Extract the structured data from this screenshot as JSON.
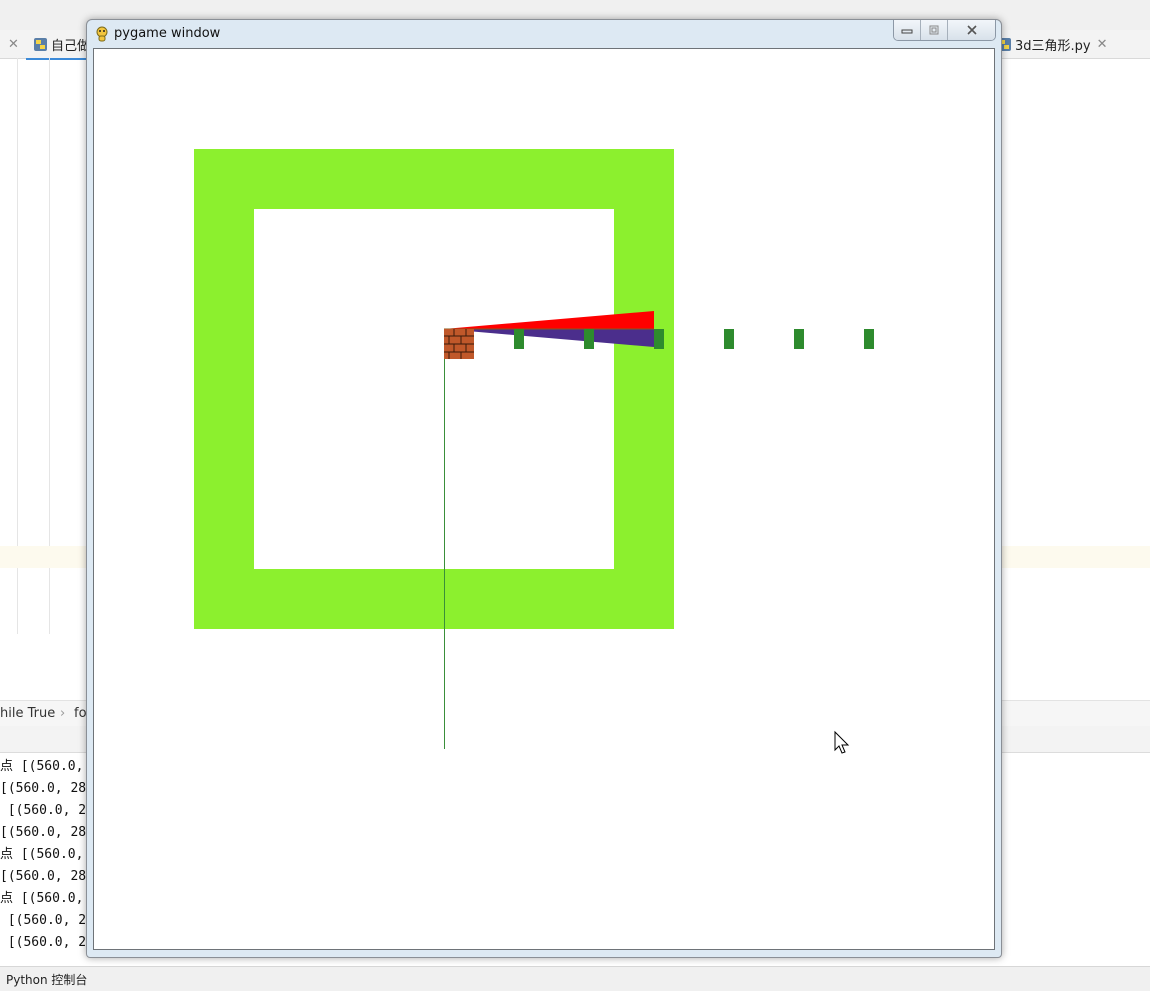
{
  "ide": {
    "tabs": [
      {
        "label": "",
        "close": "✕"
      },
      {
        "label": "自己做",
        "close": ""
      },
      {
        "label": "3d三角形.py",
        "close": "✕"
      }
    ],
    "breadcrumb": {
      "item1": "hile True",
      "sep": "›",
      "item2": "fo"
    },
    "console_lines": [
      "点 [(560.0,",
      "[(560.0, 28",
      " [(560.0, 2",
      "[(560.0, 28",
      "点 [(560.0,",
      "[(560.0, 28",
      "点 [(560.0,",
      " [(560.0, 2",
      " [(560.0, 2"
    ],
    "status_label": "Python 控制台"
  },
  "pygame": {
    "title": "pygame window",
    "colors": {
      "wall": "#8cf02e",
      "floor": "#ffffff",
      "ray_red": "#ff0000",
      "ray_purple": "#4b2e8c",
      "marker": "#2e8b2e",
      "line": "#3a8f3a",
      "brick": "#c0582a"
    }
  }
}
